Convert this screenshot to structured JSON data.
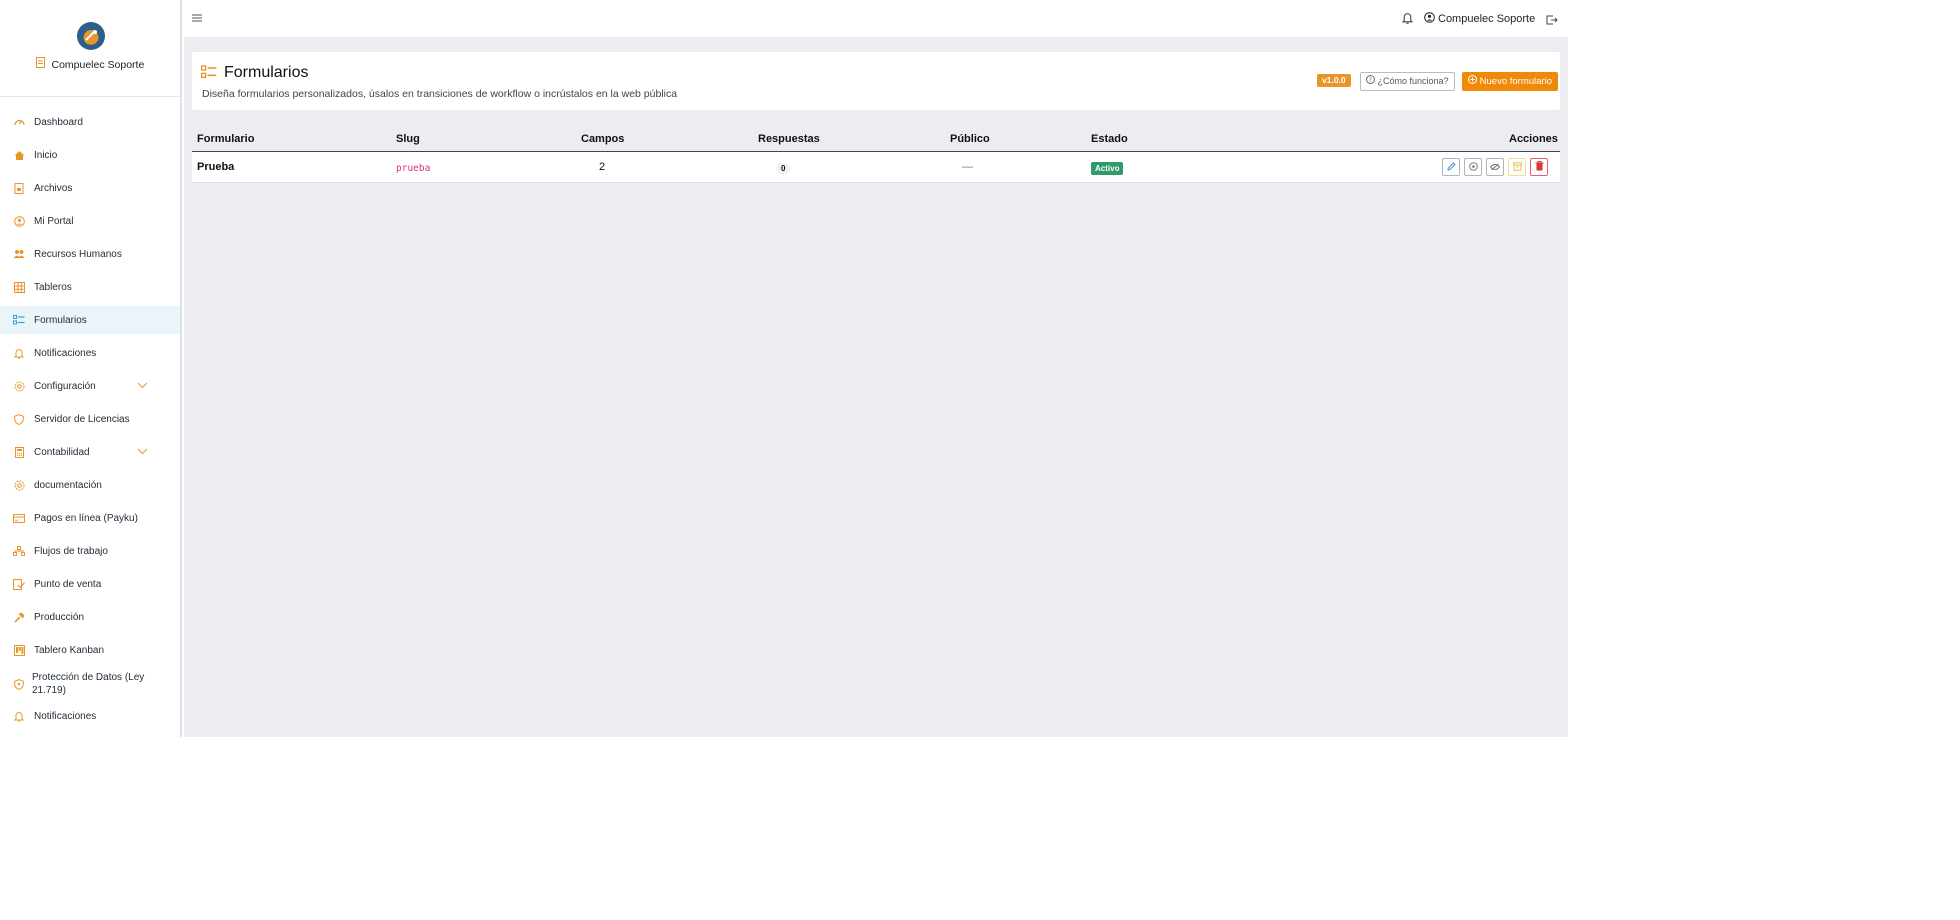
{
  "brand": {
    "name": "Compuelec Soporte"
  },
  "sidebar": {
    "items": [
      {
        "label": "Dashboard",
        "icon": "gauge-icon"
      },
      {
        "label": "Inicio",
        "icon": "home-icon"
      },
      {
        "label": "Archivos",
        "icon": "file-icon"
      },
      {
        "label": "Mi Portal",
        "icon": "user-circle-icon"
      },
      {
        "label": "Recursos Humanos",
        "icon": "users-icon"
      },
      {
        "label": "Tableros",
        "icon": "grid-icon"
      },
      {
        "label": "Formularios",
        "icon": "list-icon",
        "active": true
      },
      {
        "label": "Notificaciones",
        "icon": "bell-icon"
      },
      {
        "label": "Configuración",
        "icon": "settings-icon",
        "expandable": true
      },
      {
        "label": "Servidor de Licencias",
        "icon": "shield-icon"
      },
      {
        "label": "Contabilidad",
        "icon": "calculator-icon",
        "expandable": true
      },
      {
        "label": "documentación",
        "icon": "settings-icon"
      },
      {
        "label": "Pagos en línea (Payku)",
        "icon": "credit-card-icon"
      },
      {
        "label": "Flujos de trabajo",
        "icon": "flow-icon"
      },
      {
        "label": "Punto de venta",
        "icon": "pos-icon"
      },
      {
        "label": "Producción",
        "icon": "hammer-icon"
      },
      {
        "label": "Tablero Kanban",
        "icon": "kanban-icon"
      },
      {
        "label": "Protección de Datos (Ley 21.719)",
        "icon": "shield-icon"
      },
      {
        "label": "Notificaciones",
        "icon": "bell-icon"
      }
    ]
  },
  "topbar": {
    "user": "Compuelec Soporte"
  },
  "page": {
    "title": "Formularios",
    "subtitle": "Diseña formularios personalizados, úsalos en transiciones de workflow o incrústalos en la web pública",
    "version": "v1.0.0",
    "how_label": "¿Cómo funciona?",
    "new_label": "Nuevo formulario"
  },
  "table": {
    "headers": {
      "formulario": "Formulario",
      "slug": "Slug",
      "campos": "Campos",
      "respuestas": "Respuestas",
      "publico": "Público",
      "estado": "Estado",
      "acciones": "Acciones"
    },
    "rows": [
      {
        "formulario": "Prueba",
        "slug": "prueba",
        "campos": "2",
        "respuestas": "0",
        "publico": "—",
        "estado": "Activo"
      }
    ]
  },
  "colors": {
    "accent": "#e8962a",
    "primary_button": "#f0890a",
    "active_badge": "#2e9b6b",
    "active_nav": "#2fa6c9"
  }
}
